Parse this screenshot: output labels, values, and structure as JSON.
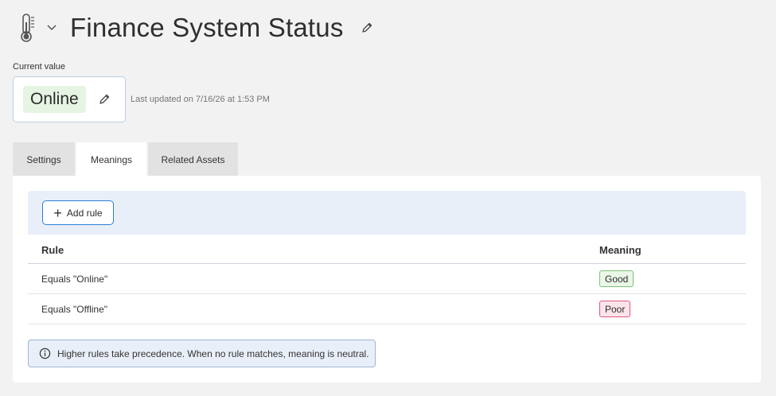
{
  "header": {
    "icon": "thermometer-icon",
    "title": "Finance System Status"
  },
  "current_value": {
    "label": "Current value",
    "value": "Online",
    "value_color": "#e6f4e3",
    "last_updated": "Last updated on 7/16/26 at 1:53 PM"
  },
  "tabs": [
    {
      "label": "Settings",
      "active": false
    },
    {
      "label": "Meanings",
      "active": true
    },
    {
      "label": "Related Assets",
      "active": false
    }
  ],
  "toolbar": {
    "add_rule_label": "Add rule"
  },
  "table": {
    "columns": [
      "Rule",
      "Meaning"
    ],
    "rows": [
      {
        "rule": "Equals \"Online\"",
        "meaning": "Good",
        "status_color": "#7cc17a"
      },
      {
        "rule": "Equals \"Offline\"",
        "meaning": "Poor",
        "status_color": "#d85b7d"
      }
    ]
  },
  "note": {
    "text": "Higher rules take precedence. When no rule matches, meaning is neutral."
  },
  "colors": {
    "accent": "#2a7fd6",
    "background": "#f2f2f2"
  }
}
